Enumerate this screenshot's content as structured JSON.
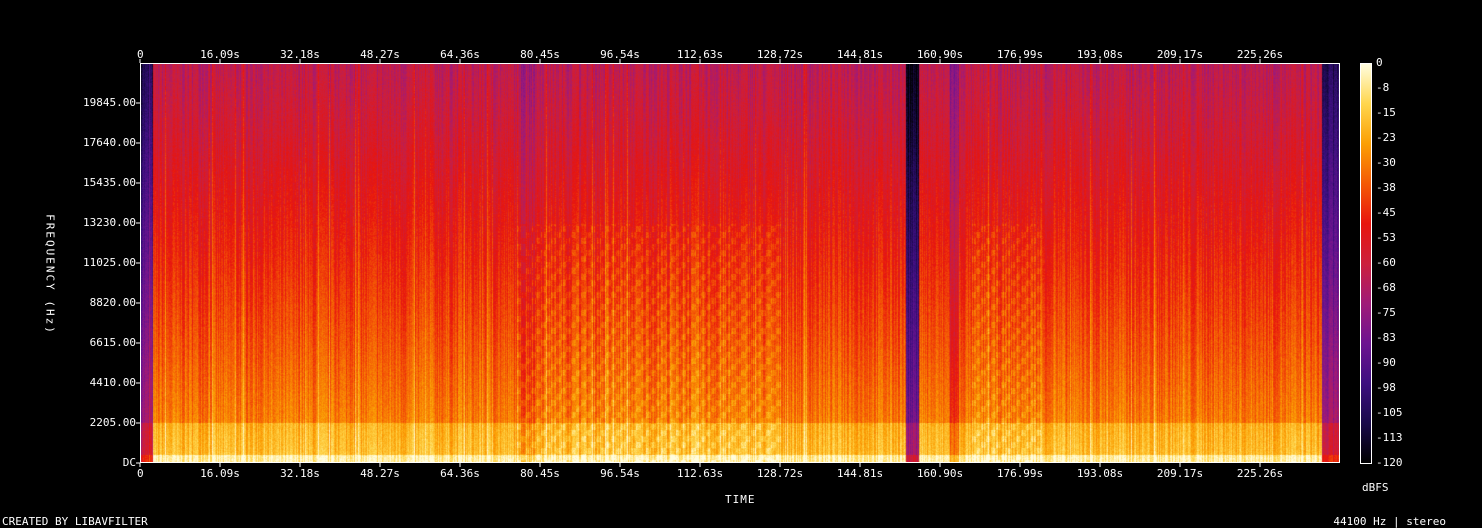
{
  "chart_data": {
    "type": "heatmap",
    "title": "",
    "xlabel": "TIME",
    "ylabel": "FREQUENCY (Hz)",
    "x_ticks": [
      "0",
      "16.09s",
      "32.18s",
      "48.27s",
      "64.36s",
      "80.45s",
      "96.54s",
      "112.63s",
      "128.72s",
      "144.81s",
      "160.90s",
      "176.99s",
      "193.08s",
      "209.17s",
      "225.26s"
    ],
    "y_ticks": [
      "DC",
      "2205.00",
      "4410.00",
      "6615.00",
      "8820.00",
      "11025.00",
      "13230.00",
      "15435.00",
      "17640.00",
      "19845.00"
    ],
    "colorbar_ticks": [
      "0",
      "-8",
      "-15",
      "-23",
      "-30",
      "-38",
      "-45",
      "-53",
      "-60",
      "-68",
      "-75",
      "-83",
      "-90",
      "-98",
      "-105",
      "-113",
      "-120"
    ],
    "colorbar_unit": "dBFS",
    "xlim": [
      0,
      241.35
    ],
    "ylim": [
      0,
      22050
    ],
    "zlim": [
      -120,
      0
    ],
    "colormap": [
      "#000000",
      "#1a0a4a",
      "#3d0f80",
      "#6d1490",
      "#a01a78",
      "#cc1f3c",
      "#e8150e",
      "#f45a05",
      "#fb9f04",
      "#ffd64d",
      "#fffde0"
    ]
  },
  "footer": {
    "left": "CREATED BY LIBAVFILTER",
    "right": "44100 Hz | stereo"
  }
}
